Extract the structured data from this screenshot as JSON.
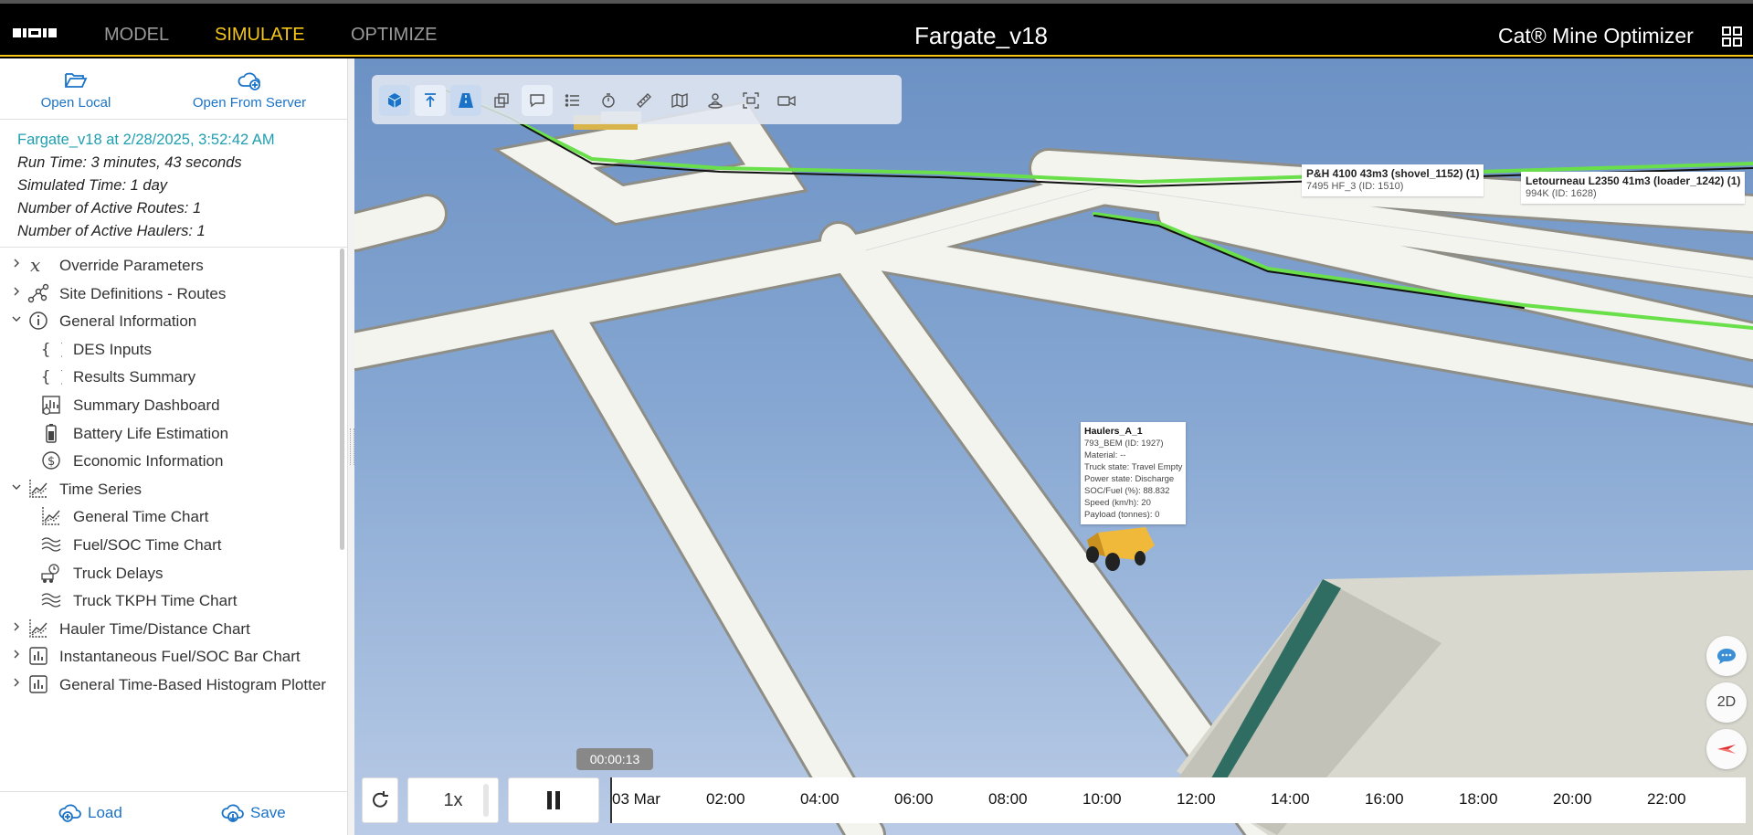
{
  "topbar": {
    "tabs": [
      "MODEL",
      "SIMULATE",
      "OPTIMIZE"
    ],
    "active_tab": "SIMULATE",
    "doc_title": "Fargate_v18",
    "brand": "Cat® Mine Optimizer",
    "accent": "#f5c518"
  },
  "sidebar": {
    "open_local": "Open Local",
    "open_server": "Open From Server",
    "info": {
      "title": "Fargate_v18 at 2/28/2025, 3:52:42 AM",
      "run_time": "Run Time: 3 minutes, 43 seconds",
      "sim_time": "Simulated Time: 1 day",
      "routes": "Number of Active Routes: 1",
      "haulers": "Number of Active Haulers: 1"
    },
    "tree": [
      {
        "label": "Override Parameters",
        "icon": "function-icon",
        "chevron": "right"
      },
      {
        "label": "Site Definitions - Routes",
        "icon": "route-nodes-icon",
        "chevron": "right"
      },
      {
        "label": "General Information",
        "icon": "info-icon",
        "chevron": "down"
      },
      {
        "label": "DES Inputs",
        "icon": "braces-icon",
        "chevron": ""
      },
      {
        "label": "Results Summary",
        "icon": "braces-icon",
        "chevron": ""
      },
      {
        "label": "Summary Dashboard",
        "icon": "dashboard-icon",
        "chevron": ""
      },
      {
        "label": "Battery Life Estimation",
        "icon": "battery-icon",
        "chevron": ""
      },
      {
        "label": "Economic Information",
        "icon": "dollar-icon",
        "chevron": ""
      },
      {
        "label": "Time Series",
        "icon": "line-chart-icon",
        "chevron": "down"
      },
      {
        "label": "General Time Chart",
        "icon": "line-chart-icon",
        "chevron": ""
      },
      {
        "label": "Fuel/SOC Time Chart",
        "icon": "wave-chart-icon",
        "chevron": ""
      },
      {
        "label": "Truck Delays",
        "icon": "truck-delay-icon",
        "chevron": ""
      },
      {
        "label": "Truck TKPH Time Chart",
        "icon": "wave-chart-icon",
        "chevron": ""
      },
      {
        "label": "Hauler Time/Distance Chart",
        "icon": "line-chart-icon",
        "chevron": "right"
      },
      {
        "label": "Instantaneous Fuel/SOC Bar Chart",
        "icon": "bar-chart-icon",
        "chevron": "right"
      },
      {
        "label": "General Time-Based Histogram Plotter",
        "icon": "bar-chart-icon",
        "chevron": "right"
      }
    ],
    "load": "Load",
    "save": "Save"
  },
  "viewport": {
    "toolbar_icons": [
      "3d-cube-icon",
      "top-view-icon",
      "road-icon",
      "layers-icon",
      "comment-icon",
      "list-icon",
      "stopwatch-icon",
      "ruler-icon",
      "map-icon",
      "person-pin-icon",
      "fit-screen-icon",
      "camera-icon"
    ],
    "labels": [
      {
        "title": "P&H 4100 43m3 (shovel_1152) (1)",
        "sub": "7495 HF_3 (ID: 1510)"
      },
      {
        "title": "Letourneau L2350 41m3 (loader_1242) (1)",
        "sub": "994K (ID: 1628)"
      }
    ],
    "hauler_popup": {
      "name": "Haulers_A_1",
      "lines": [
        "793_BEM (ID: 1927)",
        "Material: --",
        "Truck state: Travel Empty",
        "Power state: Discharge",
        "SOC/Fuel (%): 88.832",
        "Speed (km/h): 20",
        "Payload (tonnes): 0"
      ]
    },
    "view_mode": "2D"
  },
  "timeline": {
    "speed": "1x",
    "current_time": "00:00:13",
    "ticks": [
      "03 Mar",
      "02:00",
      "04:00",
      "06:00",
      "08:00",
      "10:00",
      "12:00",
      "14:00",
      "16:00",
      "18:00",
      "20:00",
      "22:00"
    ]
  }
}
